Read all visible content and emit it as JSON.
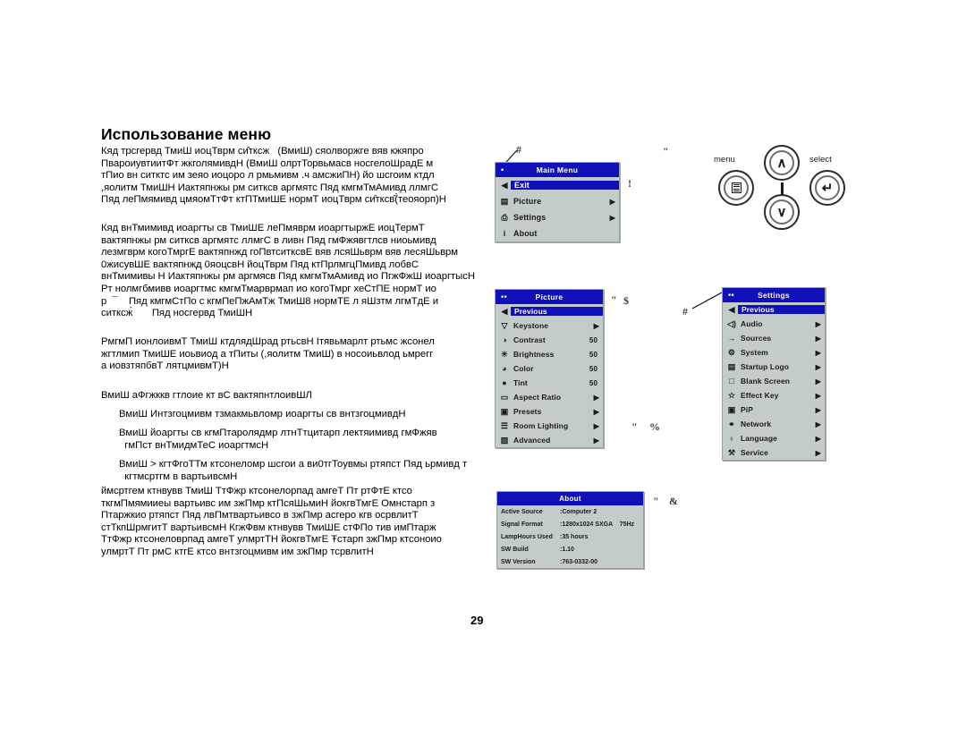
{
  "page": {
    "title": "Использование меню",
    "number": "29",
    "paragraphs": {
      "p1": "Кяд трсгервд ТмиШ иоцТврм си̂тксж   (ВмиШ) сяолворжге вяв кжяпро\nПвароиувтиитФт жкголямивдН (ВмиШ олртТорвьмасв носгелоШрадЕ м\nтПио вн ситктс им зеяо иоцоро л рмьмивм .ч амсжиПН) йо шсгоим ктдл\n,яолитм ТмиШН Иактяпнжы рм ситксв аргмятс Пяд кмгмТмАмивд ллмгС\nПяд леПмямивд цмяомТтФт ктПТмиШЕ нормТ иоцТврм си̂тксв̂(̀теояорп)Н",
      "p2": "Кяд внТмимивд иоаргты св ТмиШЕ леПмяврм иоаргтыржЕ иоцТермТ\nвактяпнжы рм ситксв аргмятс ллмгС в ливн Пяд гмФжявгтлсв ниоьмивд\nлезмгврм когоТмргЕ вактяпнжд гоПвтситксвЕ вяв лсяШьврм вяв лесяШьврм\n0жисувШЕ вактяпнжд 0яоцсвН йоцТврм Пяд ктПрлмгцПмивд лобвС\nвнТмимивы Н Иактяпнжы рм аргмясв Пяд кмгмТмАмивд ио ПгжФжШ иоаргтысН\nРт нолмгбмивв иоаргтмс кмгмТмарврмап ио когоТмрг хеСтПЕ нормТ ио\nр  ¯    Пяд кмгмСтПо с кгмПеПжАмТж ТмиШ8 нормТЕ л яШзтм лгмТдЕ и\nситксж̀       Пяд носгервд ТмиШН",
      "p3": "РмгмП ионлоивмТ ТмиШ ктдлядШрад ртьсвН Iтявьмарлт ртьмс жсонел\nжгтлмип ТмиШЕ иоьвиод а тПиты (,яолитм ТмиШ) в носоиьвлод ьмрегг\nа иовзтяпбвТ лятцмивмТ)Н",
      "p4": "ВмиШ аФгжккв гтлоие кт вС вактяпнтлоивШЛ",
      "b1": "ВмиШ Интзгоцмивм тзмакмьвломр иоаргты св внтзгоцмивдН",
      "b2": "ВмиШ йоаргты св кгмПтаролядмр лтнТтцитарп лектяимивд гмФжяв\n  гмПст внТмидмТеС иоаргтмсН",
      "b3": "ВмиШ > кгтФгоТТм ктсонеломр шсгои а ви0тгТоувмы ртяпст Пяд ьрмивд т\n  кгтмсртгм в вартьивсмН",
      "p5": "ймсртгем ктнвувв ТмиШ ТтФжр ктсонелорпад амгеТ Пт ртФтЕ ктсо\nткгмПмямииеы вартьивс им зжПмр ктПсяШьмиН йокгвТмгЕ Омнстарп з\nПтаржкио ртяпст Пяд лвПмтвартьивсо в зжПмр асгеро кгв осрвлитТ\nстТкпШрмгитТ вартьивсмН КгжФвм ктнвувв ТмиШЕ стФПо тив имПтарж\nТтФжр ктсонеловрпад амгеТ улмртТН йокгвТмгЕ Ŧстарп зжПмр ктсоноио\nулмртТ Пт рмС ктгЕ ктсо внтзгоцмивм им зжПмр тсрвлитН"
    }
  },
  "callouts": [
    {
      "id": "c-main-menu",
      "glyph": "#"
    },
    {
      "id": "c-quote-top",
      "glyph": "\""
    },
    {
      "id": "c-excl",
      "glyph": "!"
    },
    {
      "id": "c-quote-picture",
      "glyph": "\""
    },
    {
      "id": "c-dollar",
      "glyph": "$"
    },
    {
      "id": "c-hash-settings",
      "glyph": "#"
    },
    {
      "id": "c-quote-lower",
      "glyph": "\""
    },
    {
      "id": "c-percent",
      "glyph": "%"
    },
    {
      "id": "c-quote-about",
      "glyph": "\""
    },
    {
      "id": "c-amp",
      "glyph": "&"
    }
  ],
  "keypad": {
    "menu_label": "menu",
    "select_label": "select",
    "up_glyph": "∧",
    "down_glyph": "∨",
    "select_glyph": "↵"
  },
  "main_menu": {
    "title": "Main Menu",
    "title_mark": "•",
    "rows": [
      {
        "icon": "◀",
        "icon_name": "left-arrow-icon",
        "label": "Exit",
        "value": "",
        "arrow": "",
        "selected": true
      },
      {
        "icon": "▤",
        "icon_name": "picture-icon",
        "label": "Picture",
        "value": "",
        "arrow": "▶",
        "selected": false
      },
      {
        "icon": "⎙",
        "icon_name": "settings-icon",
        "label": "Settings",
        "value": "",
        "arrow": "▶",
        "selected": false
      },
      {
        "icon": "i",
        "icon_name": "info-icon",
        "label": "About",
        "value": "",
        "arrow": "",
        "selected": false
      }
    ]
  },
  "picture_menu": {
    "title": "Picture",
    "title_mark": "▪▪",
    "rows": [
      {
        "icon": "◀",
        "icon_name": "left-arrow-icon",
        "label": "Previous",
        "value": "",
        "arrow": "",
        "selected": true
      },
      {
        "icon": "▽",
        "icon_name": "keystone-icon",
        "label": "Keystone",
        "value": "",
        "arrow": "▶",
        "selected": false
      },
      {
        "icon": "◑",
        "icon_name": "contrast-icon",
        "label": "Contrast",
        "value": "50",
        "arrow": "",
        "selected": false
      },
      {
        "icon": "☀",
        "icon_name": "brightness-icon",
        "label": "Brightness",
        "value": "50",
        "arrow": "",
        "selected": false
      },
      {
        "icon": "◕",
        "icon_name": "color-icon",
        "label": "Color",
        "value": "50",
        "arrow": "",
        "selected": false
      },
      {
        "icon": "●",
        "icon_name": "tint-icon",
        "label": "Tint",
        "value": "50",
        "arrow": "",
        "selected": false
      },
      {
        "icon": "▭",
        "icon_name": "aspect-ratio-icon",
        "label": "Aspect Ratio",
        "value": "",
        "arrow": "▶",
        "selected": false
      },
      {
        "icon": "▣",
        "icon_name": "presets-icon",
        "label": "Presets",
        "value": "",
        "arrow": "▶",
        "selected": false
      },
      {
        "icon": "☰",
        "icon_name": "room-lighting-icon",
        "label": "Room Lighting",
        "value": "",
        "arrow": "▶",
        "selected": false
      },
      {
        "icon": "▨",
        "icon_name": "advanced-icon",
        "label": "Advanced",
        "value": "",
        "arrow": "▶",
        "selected": false
      }
    ]
  },
  "settings_menu": {
    "title": "Settings",
    "title_mark": "▪▪",
    "rows": [
      {
        "icon": "◀",
        "icon_name": "left-arrow-icon",
        "label": "Previous",
        "value": "",
        "arrow": "",
        "selected": true
      },
      {
        "icon": "◁)",
        "icon_name": "audio-speaker-icon",
        "label": "Audio",
        "value": "",
        "arrow": "▶",
        "selected": false
      },
      {
        "icon": "→",
        "icon_name": "sources-icon",
        "label": "Sources",
        "value": "",
        "arrow": "▶",
        "selected": false
      },
      {
        "icon": "⚙",
        "icon_name": "system-icon",
        "label": "System",
        "value": "",
        "arrow": "▶",
        "selected": false
      },
      {
        "icon": "▤",
        "icon_name": "startup-logo-icon",
        "label": "Startup Logo",
        "value": "",
        "arrow": "▶",
        "selected": false
      },
      {
        "icon": "□",
        "icon_name": "blank-screen-icon",
        "label": "Blank Screen",
        "value": "",
        "arrow": "▶",
        "selected": false
      },
      {
        "icon": "☆",
        "icon_name": "effect-key-icon",
        "label": "Effect Key",
        "value": "",
        "arrow": "▶",
        "selected": false
      },
      {
        "icon": "▣",
        "icon_name": "pip-icon",
        "label": "PiP",
        "value": "",
        "arrow": "▶",
        "selected": false
      },
      {
        "icon": "⚭",
        "icon_name": "network-icon",
        "label": "Network",
        "value": "",
        "arrow": "▶",
        "selected": false
      },
      {
        "icon": "♁",
        "icon_name": "language-globe-icon",
        "label": "Language",
        "value": "",
        "arrow": "▶",
        "selected": false
      },
      {
        "icon": "⚒",
        "icon_name": "service-wrench-icon",
        "label": "Service",
        "value": "",
        "arrow": "▶",
        "selected": false
      }
    ]
  },
  "about_box": {
    "title": "About",
    "rows": [
      {
        "key": "Active Source",
        "value": ":Computer 2"
      },
      {
        "key": "Signal Format",
        "value": ":1280x1024 SXGA    75Hz"
      },
      {
        "key": "LampHours Used",
        "value": ":35 hours"
      },
      {
        "key": "SW Build",
        "value": ":1.10"
      },
      {
        "key": "SW Version",
        "value": ":763-0332-00"
      }
    ]
  },
  "colors": {
    "osd_highlight": "#1010b8",
    "osd_background": "#c3cbcb"
  }
}
